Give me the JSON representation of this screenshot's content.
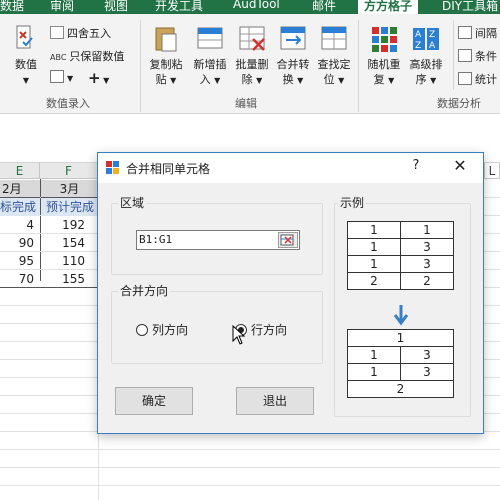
{
  "tabs": [
    "数据",
    "审阅",
    "视图",
    "开发工具",
    "AudTool",
    "邮件",
    "方方格子",
    "DIY工具箱"
  ],
  "ribbon": {
    "data_entry": {
      "label": "数值录入",
      "number_btn": "数值",
      "round_btn": "四舍五入",
      "keep_value_btn": "只保留数值",
      "plus_btn": "+"
    },
    "edit": {
      "label": "编辑",
      "copy_paste": [
        "复制粘",
        "贴"
      ],
      "insert_new": [
        "新增插",
        "入"
      ],
      "batch_delete": [
        "批量删",
        "除"
      ],
      "merge_convert": [
        "合并转",
        "换"
      ],
      "find_locate": [
        "查找定",
        "位"
      ]
    },
    "data_analysis": {
      "label": "数据分析",
      "random_shuffle": [
        "随机重",
        "复"
      ],
      "advanced_sort": [
        "高级排",
        "序"
      ],
      "interval": "间隔",
      "condition": "条件",
      "stats": "统计"
    }
  },
  "sheet": {
    "columns": [
      "E",
      "F",
      "L"
    ],
    "header_row1": [
      "2月",
      "3月"
    ],
    "header_row2": [
      "标完成",
      "预计完成"
    ],
    "rows": [
      [
        "4",
        "192"
      ],
      [
        "90",
        "154"
      ],
      [
        "95",
        "110"
      ],
      [
        "70",
        "155"
      ]
    ]
  },
  "dialog": {
    "title": "合并相同单元格",
    "help": "?",
    "close": "✕",
    "area_label": "区域",
    "range_value": "B1:G1",
    "direction_label": "合并方向",
    "col_option": "列方向",
    "row_option": "行方向",
    "selected": "row",
    "ok": "确定",
    "exit": "退出",
    "example_label": "示例",
    "example_before": [
      [
        "1",
        "1"
      ],
      [
        "1",
        "3"
      ],
      [
        "1",
        "3"
      ],
      [
        "2",
        "2"
      ]
    ],
    "example_after": {
      "r1": "1",
      "r2": [
        "1",
        "3"
      ],
      "r3": [
        "1",
        "3"
      ],
      "r4": "2"
    }
  }
}
